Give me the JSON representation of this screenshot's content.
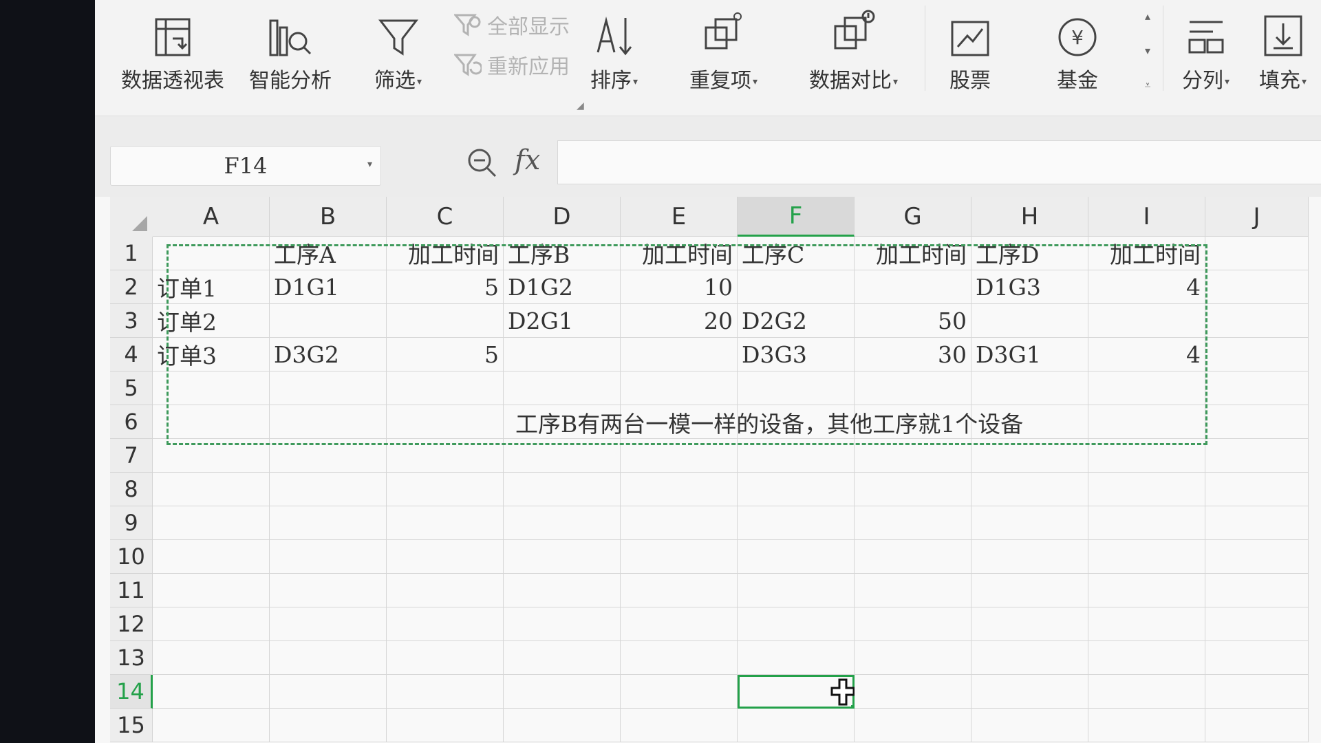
{
  "ribbon": {
    "pivot_table": "数据透视表",
    "smart_analysis": "智能分析",
    "filter": "筛选",
    "show_all": "全部显示",
    "reapply": "重新应用",
    "sort": "排序",
    "duplicates": "重复项",
    "data_compare": "数据对比",
    "stock": "股票",
    "fund": "基金",
    "split_column": "分列",
    "fill": "填充"
  },
  "formula_bar": {
    "name_box": "F14",
    "fx_label": "fx",
    "formula": ""
  },
  "columns": [
    "A",
    "B",
    "C",
    "D",
    "E",
    "F",
    "G",
    "H",
    "I",
    "J"
  ],
  "active_column": "F",
  "rows": [
    "1",
    "2",
    "3",
    "4",
    "5",
    "6",
    "7",
    "8",
    "9",
    "10",
    "11",
    "12",
    "13",
    "14",
    "15"
  ],
  "active_row": "14",
  "sheet": {
    "row1": [
      "",
      "工序A",
      "加工时间",
      "工序B",
      "加工时间",
      "工序C",
      "加工时间",
      "工序D",
      "加工时间",
      ""
    ],
    "row2": [
      "订单1",
      "D1G1",
      "5",
      "D1G2",
      "10",
      "",
      "",
      "D1G3",
      "4",
      ""
    ],
    "row3": [
      "订单2",
      "",
      "",
      "D2G1",
      "20",
      "D2G2",
      "50",
      "",
      "",
      ""
    ],
    "row4": [
      "订单3",
      "D3G2",
      "5",
      "",
      "",
      "D3G3",
      "30",
      "D3G1",
      "4",
      ""
    ]
  },
  "note": "工序B有两台一模一样的设备，其他工序就1个设备",
  "selected_cell": "F14",
  "colors": {
    "accent": "#24a14a",
    "copy_border": "#3f9a5c"
  }
}
